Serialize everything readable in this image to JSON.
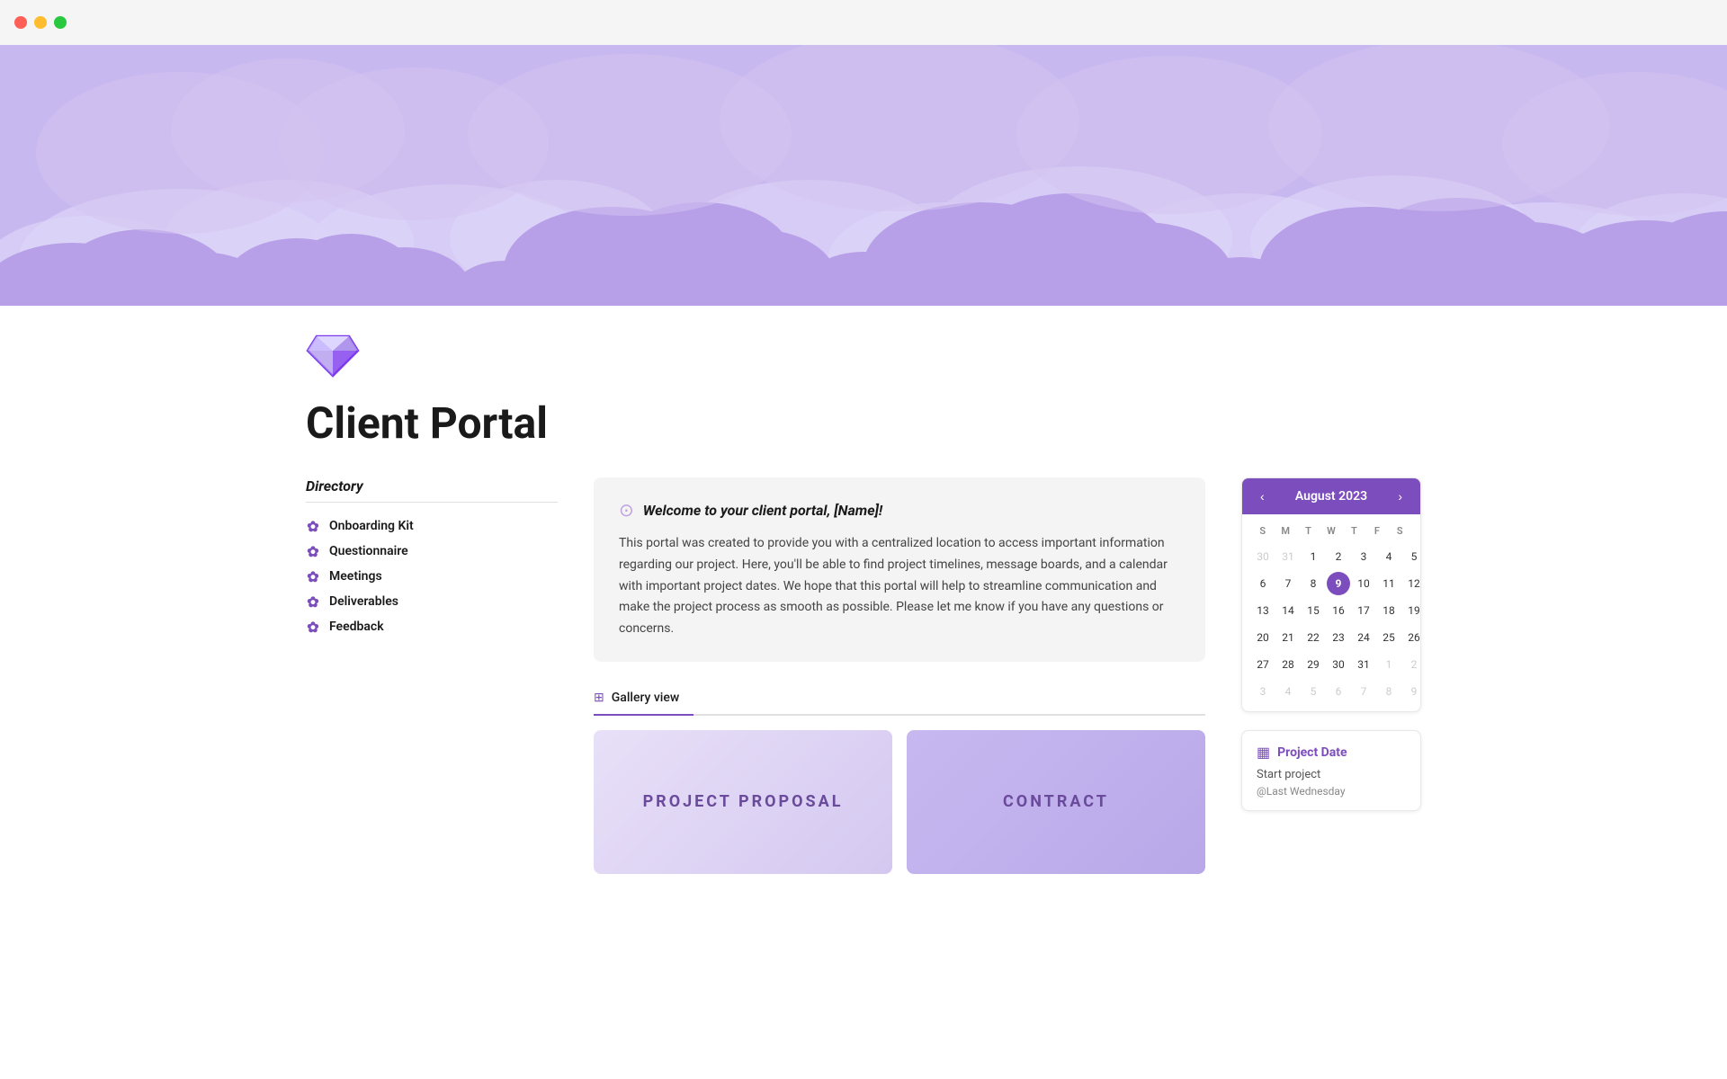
{
  "window": {
    "dots": [
      "red",
      "yellow",
      "green"
    ]
  },
  "header": {
    "banner_color": "#c8b8f0"
  },
  "page": {
    "title": "Client Portal",
    "diamond_icon": "◆"
  },
  "welcome": {
    "icon": "☀",
    "title": "Welcome to your client portal, [Name]!",
    "body": "This portal was created to provide you with a centralized location to access important information regarding our project. Here, you'll be able to find project timelines, message boards, and a calendar with important project dates. We hope that this portal will help to streamline communication and make the project process as smooth as possible. Please let me know if you have any questions or concerns."
  },
  "gallery": {
    "tab_label": "Gallery view",
    "cards": [
      {
        "label": "PROJECT PROPOSAL",
        "style": "proposal"
      },
      {
        "label": "CONTRACT",
        "style": "contract"
      }
    ]
  },
  "directory": {
    "title": "Directory",
    "items": [
      {
        "label": "Onboarding Kit"
      },
      {
        "label": "Questionnaire"
      },
      {
        "label": "Meetings"
      },
      {
        "label": "Deliverables"
      },
      {
        "label": "Feedback"
      }
    ]
  },
  "calendar": {
    "prev_label": "‹",
    "next_label": "›",
    "month_year": "August 2023",
    "weekdays": [
      "S",
      "M",
      "T",
      "W",
      "T",
      "F",
      "S"
    ],
    "weeks": [
      [
        {
          "day": "30",
          "type": "other-month"
        },
        {
          "day": "31",
          "type": "other-month"
        },
        {
          "day": "1",
          "type": "normal"
        },
        {
          "day": "2",
          "type": "normal"
        },
        {
          "day": "3",
          "type": "normal"
        },
        {
          "day": "4",
          "type": "normal"
        },
        {
          "day": "5",
          "type": "normal"
        }
      ],
      [
        {
          "day": "6",
          "type": "normal"
        },
        {
          "day": "7",
          "type": "normal"
        },
        {
          "day": "8",
          "type": "normal"
        },
        {
          "day": "9",
          "type": "today"
        },
        {
          "day": "10",
          "type": "normal"
        },
        {
          "day": "11",
          "type": "normal"
        },
        {
          "day": "12",
          "type": "normal"
        }
      ],
      [
        {
          "day": "13",
          "type": "normal"
        },
        {
          "day": "14",
          "type": "normal"
        },
        {
          "day": "15",
          "type": "normal"
        },
        {
          "day": "16",
          "type": "normal"
        },
        {
          "day": "17",
          "type": "normal"
        },
        {
          "day": "18",
          "type": "normal"
        },
        {
          "day": "19",
          "type": "normal"
        }
      ],
      [
        {
          "day": "20",
          "type": "normal"
        },
        {
          "day": "21",
          "type": "normal"
        },
        {
          "day": "22",
          "type": "normal"
        },
        {
          "day": "23",
          "type": "normal"
        },
        {
          "day": "24",
          "type": "normal"
        },
        {
          "day": "25",
          "type": "normal"
        },
        {
          "day": "26",
          "type": "normal"
        }
      ],
      [
        {
          "day": "27",
          "type": "normal"
        },
        {
          "day": "28",
          "type": "normal"
        },
        {
          "day": "29",
          "type": "normal"
        },
        {
          "day": "30",
          "type": "normal"
        },
        {
          "day": "31",
          "type": "normal"
        },
        {
          "day": "1",
          "type": "other-month"
        },
        {
          "day": "2",
          "type": "other-month"
        }
      ],
      [
        {
          "day": "3",
          "type": "other-month"
        },
        {
          "day": "4",
          "type": "other-month"
        },
        {
          "day": "5",
          "type": "other-month"
        },
        {
          "day": "6",
          "type": "other-month"
        },
        {
          "day": "7",
          "type": "other-month"
        },
        {
          "day": "8",
          "type": "other-month"
        },
        {
          "day": "9",
          "type": "other-month"
        }
      ]
    ]
  },
  "project_date": {
    "icon": "📅",
    "title": "Project Date",
    "start_label": "Start project",
    "start_value": "@Last Wednesday"
  }
}
